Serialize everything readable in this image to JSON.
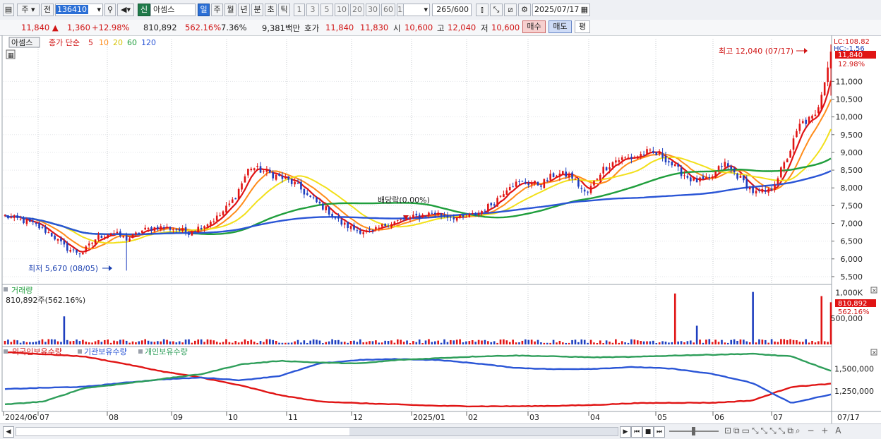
{
  "toolbar": {
    "mode_label": "주",
    "prev_label": "전",
    "code": "136410",
    "new_badge": "신",
    "stock_name": "아셈스",
    "period_buttons": [
      "일",
      "주",
      "월",
      "년",
      "분",
      "초",
      "틱"
    ],
    "interval_buttons": [
      "1",
      "3",
      "5",
      "10",
      "20",
      "30",
      "60",
      "120"
    ],
    "count_value": "265",
    "count_total": "/600",
    "date": "2025/07/17"
  },
  "info": {
    "price": "11,840",
    "change": "1,360",
    "change_pct": "+12.98%",
    "volume": "810,892",
    "volume_ratio": "562.16%",
    "turnover": "7.36%",
    "amount": "9,381백만",
    "quote_label": "호가",
    "ask": "11,840",
    "bid": "11,830",
    "open_label": "시",
    "open": "10,600",
    "high_label": "고",
    "high": "12,040",
    "low_label": "저",
    "low": "10,600",
    "buy_label": "매수",
    "sell_label": "매도",
    "avg_label": "평"
  },
  "price_panel": {
    "legend_name": "아셈스",
    "legend_ma": "종가 단순",
    "ma_periods": [
      "5",
      "10",
      "20",
      "60",
      "120"
    ],
    "high_annotation": "최고 12,040 (07/17)",
    "low_annotation": "최저 5,670 (08/05)",
    "dividend_annotation": "배당락(0.00%)",
    "lc_label": "LC:108.82",
    "hc_label": "HC:-1.56",
    "current_price_tag": "11,840",
    "current_pct_tag": "12.98%"
  },
  "volume_panel": {
    "title": "거래량",
    "value_label": "810,892주(562.16%)",
    "current_tag": "810,892",
    "current_pct_tag": "562.16%"
  },
  "holdings_panel": {
    "series_labels": [
      "외국인보유수량",
      "기관보유수량",
      "개인보유수량"
    ]
  },
  "x_axis": {
    "labels": [
      "2024/06",
      "07",
      "08",
      "09",
      "10",
      "11",
      "12",
      "2025/01",
      "02",
      "03",
      "04",
      "05",
      "06",
      "07"
    ],
    "right_label": "07/17"
  },
  "colors": {
    "up": "#e01414",
    "down": "#1f3fbf",
    "ma5": "#e01414",
    "ma10": "#ff8c1a",
    "ma20": "#f2e01a",
    "ma60": "#1f9e3c",
    "ma120": "#2a55d6",
    "foreign": "#e01414",
    "institution": "#2a55d6",
    "individual": "#2e9e5a"
  },
  "chart_data": [
    {
      "type": "line",
      "title": "아셈스",
      "y_ticks": [
        5500,
        6000,
        6500,
        7000,
        7500,
        8000,
        8500,
        9000,
        9500,
        10000,
        10500,
        11000
      ],
      "ylim": [
        5300,
        12200
      ],
      "x_month_labels": [
        "2024/06",
        "07",
        "08",
        "09",
        "10",
        "11",
        "12",
        "2025/01",
        "02",
        "03",
        "04",
        "05",
        "06",
        "07"
      ],
      "close_anchors": [
        7200,
        7100,
        6950,
        6700,
        6300,
        6150,
        6600,
        6750,
        6550,
        6800,
        6900,
        6850,
        6750,
        6950,
        7200,
        7700,
        8600,
        8450,
        8300,
        8100,
        7700,
        7400,
        7000,
        6800,
        6750,
        7000,
        7100,
        7200,
        7300,
        7200,
        7150,
        7300,
        7600,
        8100,
        8150,
        8100,
        8400,
        8350,
        7800,
        8500,
        8800,
        8850,
        9000,
        8900,
        8500,
        8200,
        8200,
        8700,
        8300,
        7850,
        7900,
        8700,
        9800,
        10000,
        11840
      ],
      "series": [
        {
          "name": "5",
          "period": 5
        },
        {
          "name": "10",
          "period": 10
        },
        {
          "name": "20",
          "period": 20
        },
        {
          "name": "60",
          "period": 60
        },
        {
          "name": "120",
          "period": 120
        }
      ],
      "high": {
        "value": 12040,
        "date": "07/17"
      },
      "low": {
        "value": 5670,
        "date": "08/05"
      },
      "last": 11840
    },
    {
      "type": "bar",
      "title": "거래량",
      "y_ticks": [
        500000,
        1000000
      ],
      "y_tick_labels": [
        "500,000",
        "1,000K"
      ],
      "spikes": {
        "19": 540000,
        "215": 980000,
        "222": 360000,
        "240": 1010000,
        "262": 930000,
        "265": 810892
      },
      "baseline_level": 65000,
      "last": 810892
    },
    {
      "type": "line",
      "title": "보유수량",
      "y_ticks": [
        1250000,
        1500000
      ],
      "y_tick_labels": [
        "1,250,000",
        "1,500,000"
      ],
      "series": [
        {
          "name": "외국인보유수량",
          "anchors": [
            1690000,
            1665000,
            1640000,
            1560000,
            1470000,
            1400000,
            1310000,
            1200000,
            1130000,
            1110000,
            1095000,
            1080000,
            1075000,
            1075000,
            1080000,
            1090000,
            1110000,
            1115000,
            1115000,
            1140000,
            1295000,
            1330000
          ]
        },
        {
          "name": "기관보유수량",
          "anchors": [
            1270000,
            1285000,
            1295000,
            1340000,
            1380000,
            1400000,
            1370000,
            1420000,
            1560000,
            1600000,
            1610000,
            1600000,
            1560000,
            1510000,
            1495000,
            1500000,
            1520000,
            1500000,
            1440000,
            1340000,
            1110000,
            1210000
          ]
        },
        {
          "name": "개인보유수량",
          "anchors": [
            1095000,
            1130000,
            1280000,
            1330000,
            1385000,
            1440000,
            1550000,
            1590000,
            1570000,
            1560000,
            1600000,
            1620000,
            1640000,
            1650000,
            1640000,
            1630000,
            1635000,
            1650000,
            1660000,
            1670000,
            1640000,
            1475000
          ]
        }
      ]
    }
  ]
}
